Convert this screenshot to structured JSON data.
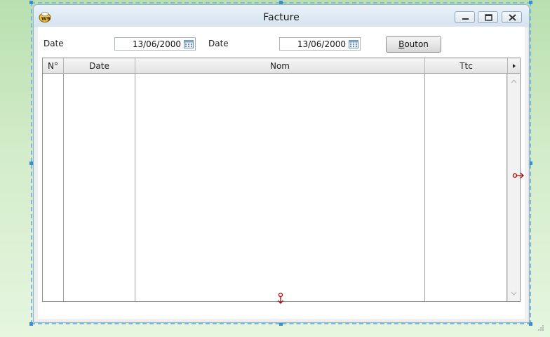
{
  "window": {
    "title": "Facture",
    "icon": "windev-app-icon",
    "controls": [
      "minimize-icon",
      "restore-icon",
      "close-icon"
    ]
  },
  "filters": {
    "date1_label": "Date",
    "date1_value": "13/06/2000",
    "date2_label": "Date",
    "date2_value": "13/06/2000",
    "button_label_u": "B",
    "button_label_rest": "outon"
  },
  "table": {
    "columns": [
      "N°",
      "Date",
      "Nom",
      "Ttc"
    ],
    "rows": []
  },
  "colors": {
    "background_green": "#c8e8bf",
    "window_bg": "#f0f0f0",
    "anchor_red": "#b00000",
    "selection_blue": "#3a8fd0"
  }
}
